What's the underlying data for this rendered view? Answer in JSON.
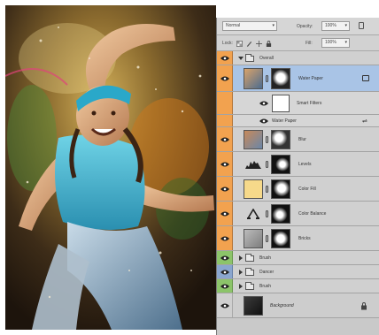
{
  "layers_panel": {
    "blend_mode": "Normal",
    "opacity_label": "Opacity:",
    "opacity_value": "100%",
    "lock_label": "Lock:",
    "fill_label": "Fill:",
    "fill_value": "100%",
    "layers": [
      {
        "name": "Overall",
        "kind": "group",
        "expanded": true,
        "color": "orange"
      },
      {
        "name": "Water Paper",
        "kind": "smart-object",
        "selected": true,
        "color": "orange"
      },
      {
        "name": "Smart Filters",
        "kind": "smart-filters",
        "color": "orange"
      },
      {
        "name": "Water Paper",
        "kind": "filter",
        "color": "orange"
      },
      {
        "name": "Blur",
        "kind": "image-mask",
        "color": "orange"
      },
      {
        "name": "Levels",
        "kind": "adjustment",
        "color": "orange"
      },
      {
        "name": "Color Fill",
        "kind": "fill",
        "color": "orange",
        "fill_color": "#f6d98a"
      },
      {
        "name": "Color Balance",
        "kind": "adjustment",
        "color": "orange"
      },
      {
        "name": "Bricks",
        "kind": "image-mask",
        "color": "orange"
      },
      {
        "name": "Brush",
        "kind": "group",
        "expanded": false,
        "color": "green"
      },
      {
        "name": "Dancer",
        "kind": "group",
        "expanded": false,
        "color": "blue"
      },
      {
        "name": "Brush",
        "kind": "group",
        "expanded": false,
        "color": "green"
      },
      {
        "name": "Background",
        "kind": "background",
        "locked": true,
        "color": "none"
      }
    ]
  },
  "colors": {
    "orange_label": "#f2a24f",
    "green_label": "#8cc46a",
    "blue_label": "#8aa6cf",
    "selection": "#a9c4e6",
    "panel_bg": "#c9c9c9"
  },
  "icons": [
    "eye-icon",
    "folder-icon",
    "chain-link-icon",
    "lock-icon",
    "brush-lock-icon",
    "move-lock-icon",
    "smart-object-icon",
    "filter-options-icon",
    "levels-icon",
    "color-balance-icon"
  ]
}
